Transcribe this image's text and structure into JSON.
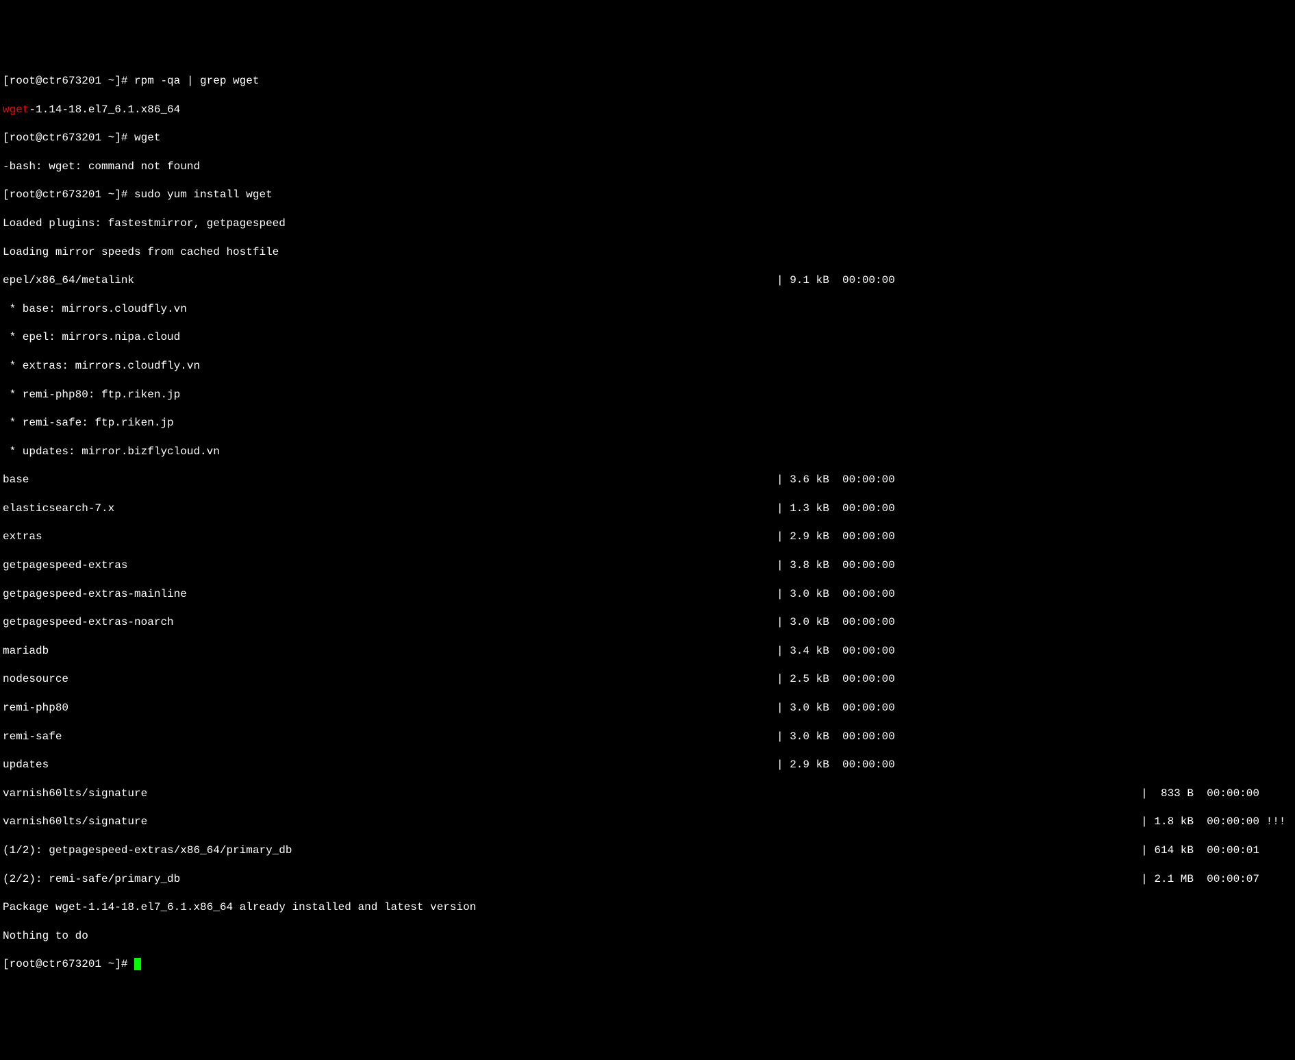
{
  "cmd1": {
    "prompt": "[root@ctr673201 ~]# ",
    "command": "rpm -qa | grep wget"
  },
  "output1": {
    "match_red": "wget",
    "match_rest": "-1.14-18.el7_6.1.x86_64"
  },
  "cmd2": {
    "prompt": "[root@ctr673201 ~]# ",
    "command": "wget"
  },
  "output2": "-bash: wget: command not found",
  "cmd3": {
    "prompt": "[root@ctr673201 ~]# ",
    "command": "sudo yum install wget"
  },
  "plugins": "Loaded plugins: fastestmirror, getpagespeed",
  "loading": "Loading mirror speeds from cached hostfile",
  "epel_meta": {
    "name": "epel/x86_64/metalink",
    "size": "| 9.1 kB  00:00:00     "
  },
  "mirrors": {
    "base": " * base: mirrors.cloudfly.vn",
    "epel": " * epel: mirrors.nipa.cloud",
    "extras": " * extras: mirrors.cloudfly.vn",
    "remi_php80": " * remi-php80: ftp.riken.jp",
    "remi_safe": " * remi-safe: ftp.riken.jp",
    "updates": " * updates: mirror.bizflycloud.vn"
  },
  "repos": [
    {
      "name": "base",
      "size": "| 3.6 kB  00:00:00     "
    },
    {
      "name": "elasticsearch-7.x",
      "size": "| 1.3 kB  00:00:00     "
    },
    {
      "name": "extras",
      "size": "| 2.9 kB  00:00:00     "
    },
    {
      "name": "getpagespeed-extras",
      "size": "| 3.8 kB  00:00:00     "
    },
    {
      "name": "getpagespeed-extras-mainline",
      "size": "| 3.0 kB  00:00:00     "
    },
    {
      "name": "getpagespeed-extras-noarch",
      "size": "| 3.0 kB  00:00:00     "
    },
    {
      "name": "mariadb",
      "size": "| 3.4 kB  00:00:00     "
    },
    {
      "name": "nodesource",
      "size": "| 2.5 kB  00:00:00     "
    },
    {
      "name": "remi-php80",
      "size": "| 3.0 kB  00:00:00     "
    },
    {
      "name": "remi-safe",
      "size": "| 3.0 kB  00:00:00     "
    },
    {
      "name": "updates",
      "size": "| 2.9 kB  00:00:00     "
    }
  ],
  "varnish1": {
    "name": "varnish60lts/signature",
    "size": "|  833 B  00:00:00     "
  },
  "varnish2": {
    "name": "varnish60lts/signature",
    "size": "| 1.8 kB  00:00:00 !!! "
  },
  "dl1": {
    "name": "(1/2): getpagespeed-extras/x86_64/primary_db",
    "size": "| 614 kB  00:00:01     "
  },
  "dl2": {
    "name": "(2/2): remi-safe/primary_db",
    "size": "| 2.1 MB  00:00:07     "
  },
  "installed": "Package wget-1.14-18.el7_6.1.x86_64 already installed and latest version",
  "nothing": "Nothing to do",
  "final_prompt": "[root@ctr673201 ~]# "
}
